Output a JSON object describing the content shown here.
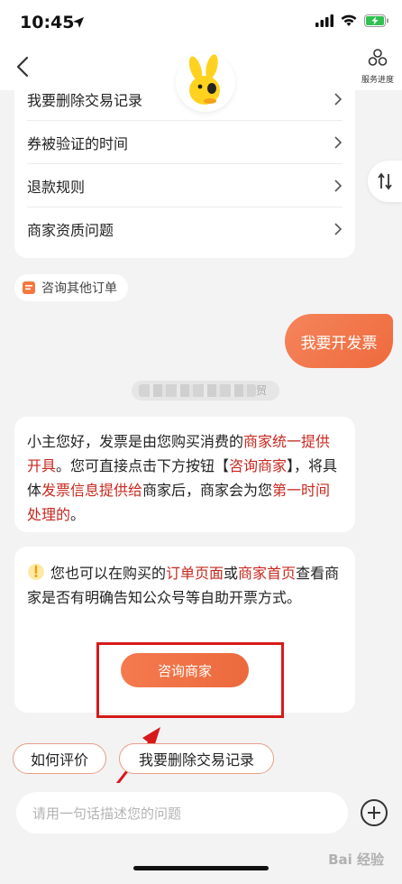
{
  "status": {
    "time": "10:45"
  },
  "header": {
    "service_label": "服务进度"
  },
  "faq": {
    "items": [
      {
        "label": "我要删除交易记录"
      },
      {
        "label": "券被验证的时间"
      },
      {
        "label": "退款规则"
      },
      {
        "label": "商家资质问题"
      }
    ]
  },
  "other_order": {
    "label": "咨询其他订单"
  },
  "user_message": {
    "text": "我要开发票"
  },
  "timestamp_tail": "贸",
  "answer": {
    "p1": "小主您好，发票是由您购买消费的",
    "h1": "商家统一提供开具",
    "p2": "。您可直接点击下方按钮【",
    "h2": "咨询商家",
    "p3": "】，将具体",
    "h3": "发票信息提供给",
    "p4": "商家后，商家会为您",
    "h4": "第一时间处理的",
    "p5": "。"
  },
  "tip": {
    "p1": "您也可以在购买的",
    "h1": "订单页面",
    "p2": "或",
    "h2": "商家首页",
    "p3": "查看商家是否有明确告知公众号等自助开票方式。",
    "button_label": "咨询商家"
  },
  "quick_replies": [
    {
      "label": "如何评价"
    },
    {
      "label": "我要删除交易记录"
    }
  ],
  "input": {
    "placeholder": "请用一句话描述您的问题"
  },
  "watermark": "Bai 经验",
  "colors": {
    "accent": "#ee6a3c",
    "highlight": "#c7281f",
    "annotation": "#d61a1a"
  }
}
